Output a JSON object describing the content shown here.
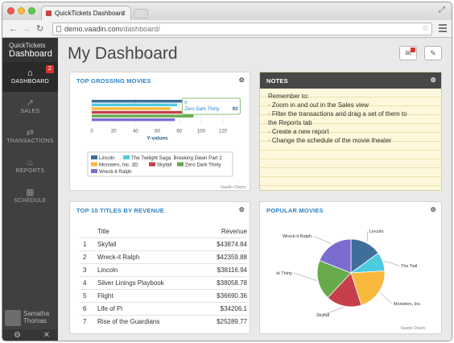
{
  "browser": {
    "tab_title": "QuickTickets Dashboard",
    "url_host": "demo.vaadin.com",
    "url_path": "/dashboard/"
  },
  "sidebar": {
    "logo_line1": "QuickTickets",
    "logo_line2": "Dashboard",
    "items": [
      {
        "label": "DASHBOARD",
        "icon": "home-icon",
        "badge": "2"
      },
      {
        "label": "SALES",
        "icon": "chart-icon"
      },
      {
        "label": "TRANSACTIONS",
        "icon": "arrows-icon"
      },
      {
        "label": "REPORTS",
        "icon": "flame-icon"
      },
      {
        "label": "SCHEDULE",
        "icon": "calendar-icon"
      }
    ],
    "user_first": "Samatha",
    "user_last": "Thomas"
  },
  "header": {
    "title": "My Dashboard"
  },
  "panels": {
    "top_grossing": "TOP GROSSING MOVIES",
    "notes": "NOTES",
    "top10": "TOP 10 TITLES BY REVENUE",
    "popular": "POPULAR MOVIES"
  },
  "notes": {
    "lines": [
      "Remember to:",
      "· Zoom in and out in the Sales view",
      "· Filter the transactions and drag a set of them to",
      "the Reports tab",
      "· Create a new report",
      "· Change the schedule of the movie theater"
    ]
  },
  "revenue_table": {
    "headers": [
      "Title",
      "Revenue"
    ],
    "rows": [
      {
        "n": "1",
        "title": "Skyfall",
        "revenue": "$43874.84"
      },
      {
        "n": "2",
        "title": "Wreck-it Ralph",
        "revenue": "$42359.88"
      },
      {
        "n": "3",
        "title": "Lincoln",
        "revenue": "$38116.94"
      },
      {
        "n": "4",
        "title": "Silver Linings Playbook",
        "revenue": "$38058.78"
      },
      {
        "n": "5",
        "title": "Flight",
        "revenue": "$36690.36"
      },
      {
        "n": "6",
        "title": "Life of Pi",
        "revenue": "$34206.1"
      },
      {
        "n": "7",
        "title": "Rise of the Guardians",
        "revenue": "$25289.77"
      }
    ]
  },
  "chart_credit": "Vaadin Charts",
  "colors": {
    "accent": "#2e82c5",
    "badge": "#d9352b"
  },
  "chart_data": [
    {
      "type": "bar",
      "orientation": "horizontal",
      "xlabel": "Y-values",
      "xlim": [
        0,
        120
      ],
      "ticks": [
        "0",
        "20",
        "40",
        "60",
        "80",
        "100",
        "120"
      ],
      "tooltip": {
        "series": "Zero Dark Thirty",
        "value": "93"
      },
      "series": [
        {
          "name": "Lincoln",
          "color": "#3f6e9a",
          "value": 85
        },
        {
          "name": "The Twilight Saga: Breaking Dawn Part 2",
          "color": "#4fcbe0",
          "value": 78
        },
        {
          "name": "Monsters, Inc. 3D",
          "color": "#f8b93c",
          "value": 72
        },
        {
          "name": "Skyfall",
          "color": "#c5404b",
          "value": 90
        },
        {
          "name": "Zero Dark Thirty",
          "color": "#66aa4a",
          "value": 93
        },
        {
          "name": "Wreck-it Ralph",
          "color": "#7b6cd0",
          "value": 76
        }
      ]
    },
    {
      "type": "pie",
      "slices": [
        {
          "label": "Lincoln",
          "color": "#3f6e9a",
          "value": 15
        },
        {
          "label": "The Twil",
          "color": "#4fcbe0",
          "value": 9
        },
        {
          "label": "Monsters, Inc.",
          "color": "#f8b93c",
          "value": 21
        },
        {
          "label": "Skyfall",
          "color": "#c5404b",
          "value": 17
        },
        {
          "label": "rk Thirty",
          "color": "#66aa4a",
          "value": 19
        },
        {
          "label": "Wreck-it Ralph",
          "color": "#7b6cd0",
          "value": 19
        }
      ]
    }
  ]
}
